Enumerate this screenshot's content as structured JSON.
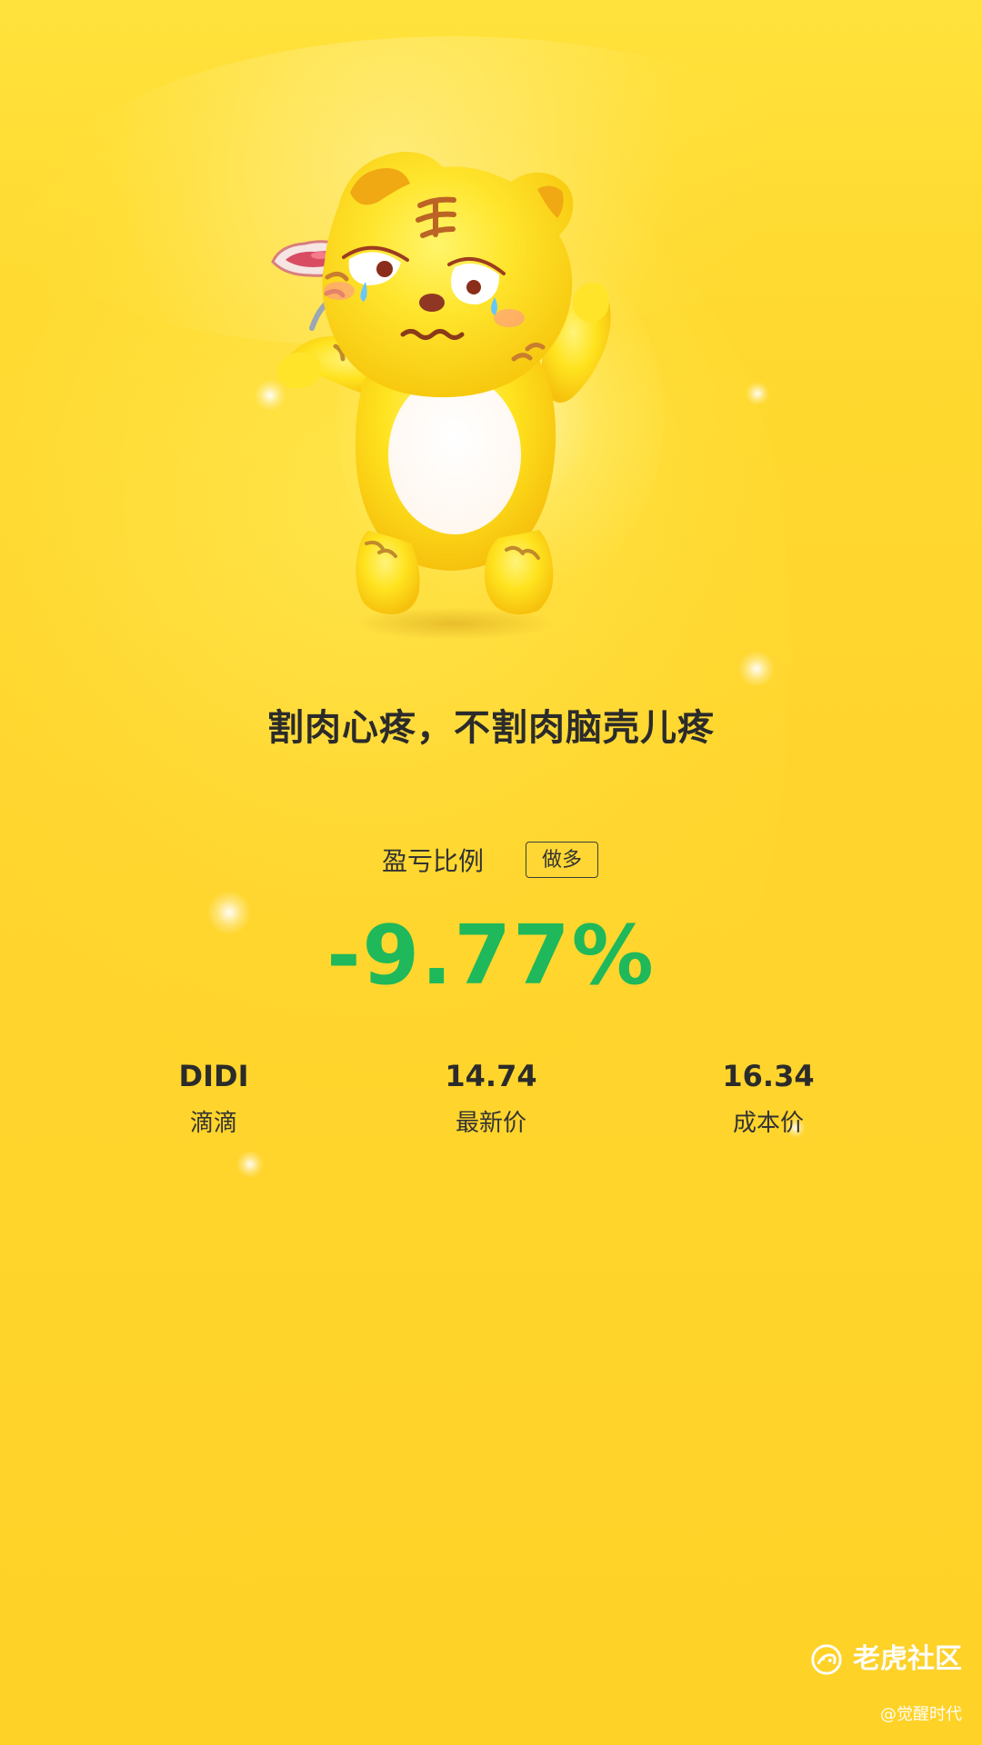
{
  "colors": {
    "background": "#ffd42d",
    "highlight": "#fff3a5",
    "text_dark": "#2b2b2b",
    "text_medium": "#333333",
    "loss_green": "#1fb85a",
    "watermark": "#ffffff"
  },
  "mascot": {
    "icon": "tiger-mascot-icon",
    "holding": "meat-on-fork-icon"
  },
  "headline": "割肉心疼，不割肉脑壳儿疼",
  "profit": {
    "label": "盈亏比例",
    "position_badge": "做多",
    "percent": "-9.77%",
    "value": -9.77
  },
  "stats": [
    {
      "value": "DIDI",
      "label": "滴滴"
    },
    {
      "value": "14.74",
      "label": "最新价"
    },
    {
      "value": "16.34",
      "label": "成本价"
    }
  ],
  "watermark": {
    "brand": "老虎社区",
    "author": "@觉醒时代",
    "icon": "tiger-community-logo-icon"
  }
}
